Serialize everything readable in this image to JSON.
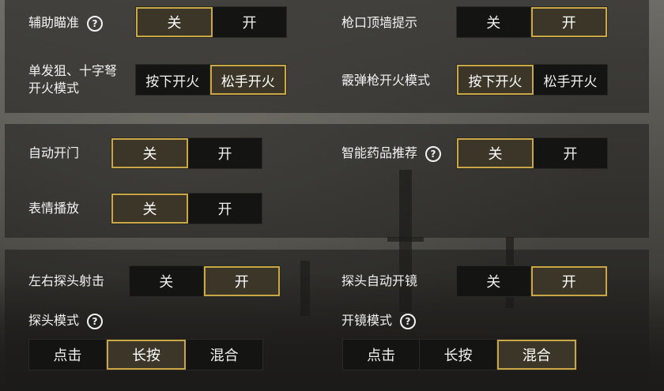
{
  "accent_color": "#c9a646",
  "icons": {
    "help": "question-circle-icon"
  },
  "help_glyph": "?",
  "section1": {
    "aim_assist": {
      "label": "辅助瞄准",
      "options": [
        "关",
        "开"
      ],
      "selected": "关"
    },
    "muzzle_wall_hint": {
      "label": "枪口顶墙提示",
      "options": [
        "关",
        "开"
      ],
      "selected": "开"
    },
    "sniper_crossbow_fire_mode": {
      "label_line1": "单发狙、十字弩",
      "label_line2": "开火模式",
      "options": [
        "按下开火",
        "松手开火"
      ],
      "selected": "松手开火"
    },
    "shotgun_fire_mode": {
      "label": "霰弹枪开火模式",
      "options": [
        "按下开火",
        "松手开火"
      ],
      "selected": "按下开火"
    }
  },
  "section2": {
    "auto_open_door": {
      "label": "自动开门",
      "options": [
        "关",
        "开"
      ],
      "selected": "关"
    },
    "smart_med_recommend": {
      "label": "智能药品推荐",
      "options": [
        "关",
        "开"
      ],
      "selected": "关"
    },
    "emote_play": {
      "label": "表情播放",
      "options": [
        "关",
        "开"
      ],
      "selected": "关"
    }
  },
  "section3": {
    "lean_fire": {
      "label": "左右探头射击",
      "options": [
        "关",
        "开"
      ],
      "selected": "开"
    },
    "lean_auto_scope": {
      "label": "探头自动开镜",
      "options": [
        "关",
        "开"
      ],
      "selected": "开"
    },
    "lean_mode": {
      "label": "探头模式",
      "options": [
        "点击",
        "长按",
        "混合"
      ],
      "selected": "长按"
    },
    "scope_mode": {
      "label": "开镜模式",
      "options": [
        "点击",
        "长按",
        "混合"
      ],
      "selected": "混合"
    }
  }
}
